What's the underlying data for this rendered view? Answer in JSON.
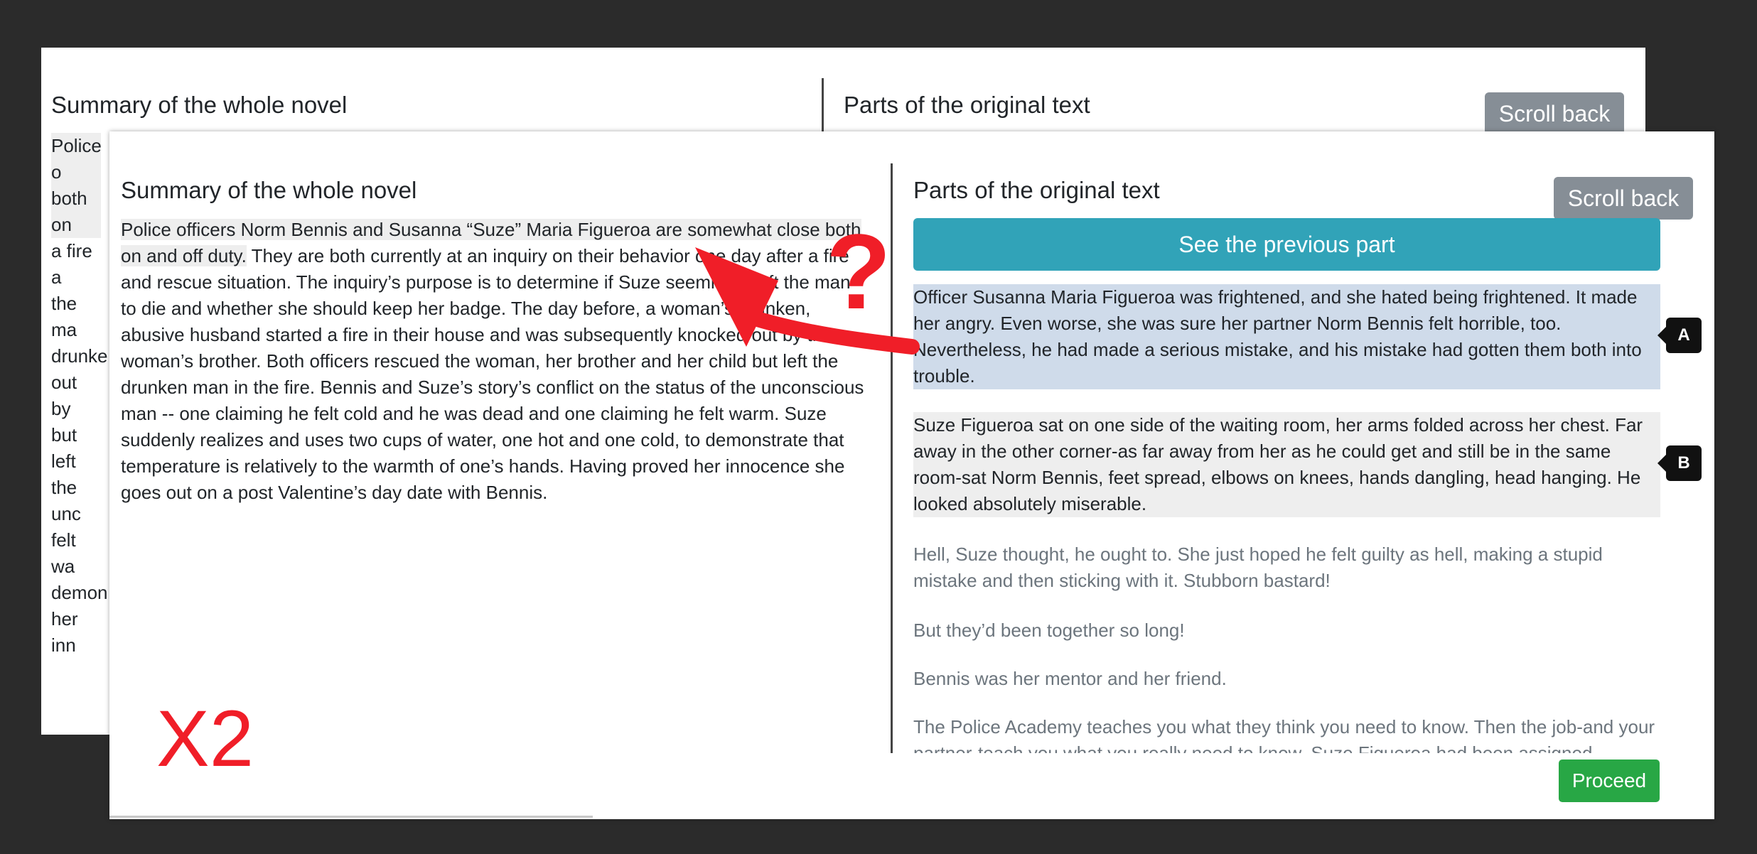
{
  "back_window": {
    "summary_title": "Summary of the whole novel",
    "original_title": "Parts of the original text",
    "scroll_back": "Scroll back",
    "summary_lines": [
      "Police o",
      "both on",
      "a fire a",
      "the ma",
      "drunke",
      "out by",
      "but left",
      "the unc",
      "felt wa",
      "demon",
      "her inn"
    ]
  },
  "front_window": {
    "summary_title": "Summary of the whole novel",
    "summary_highlight": "Police officers Norm Bennis and Susanna “Suze” Maria Figueroa are somewhat close both on and off duty.",
    "summary_rest": " They are both currently at an inquiry on their behavior one day after a fire and rescue situation. The inquiry’s purpose is to determine if Suze seemingly left the man to die and whether she should keep her badge. The day before, a woman’s drunken, abusive husband started a fire in their house and was subsequently knocked out by the woman’s brother. Both officers rescued the woman, her brother and her child but left the drunken man in the fire. Bennis and Suze’s story’s conflict on the status of the unconscious man -- one claiming he felt cold and he was dead and one claiming he felt warm. Suze suddenly realizes and uses two cups of water, one hot and one cold, to demonstrate that temperature is relatively to the warmth of one’s hands. Having proved her innocence she goes out on a post Valentine’s day date with Bennis.",
    "original_title": "Parts of the original text",
    "scroll_back": "Scroll back",
    "see_previous": "See the previous part",
    "paragraphs": [
      "Officer Susanna Maria Figueroa was frightened, and she hated being frightened. It made her angry. Even worse, she was sure her partner Norm Bennis felt horrible, too. Nevertheless, he had made a serious mistake, and his mistake had gotten them both into trouble.",
      "Suze Figueroa sat on one side of the waiting room, her arms folded across her chest. Far away in the other corner-as far away from her as he could get and still be in the same room-sat Norm Bennis, feet spread, elbows on knees, hands dangling, head hanging. He looked absolutely miserable.",
      "Hell, Suze thought, he ought to. She just hoped he felt guilty as hell, making a stupid mistake and then sticking with it. Stubborn bastard!",
      "But they’d been together so long!",
      "Bennis was her mentor and her friend.",
      "The Police Academy teaches you what they think you need to know. Then the job-and your partner-teach you what you really need to know. Suze Figueroa had been assigned"
    ],
    "badge_a": "A",
    "badge_b": "B",
    "proceed": "Proceed"
  },
  "annotations": {
    "question_mark": "?",
    "multiplier": "X2",
    "arrow_color": "#f01e28"
  }
}
